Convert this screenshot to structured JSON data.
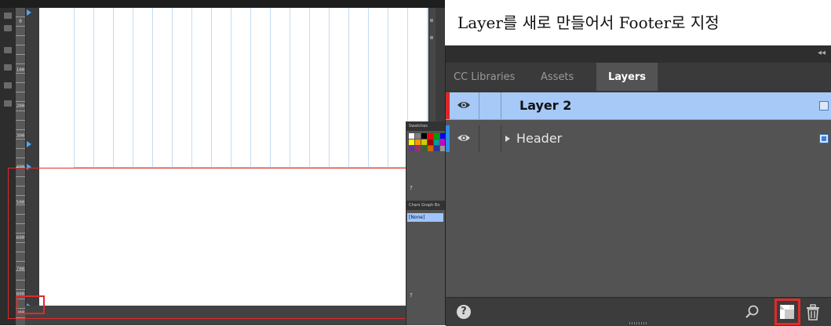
{
  "caption": {
    "text": "Layer를 새로 만들어서 Footer로 지정"
  },
  "layers_panel": {
    "tabs": [
      {
        "label": "CC Libraries",
        "active": false
      },
      {
        "label": "Assets",
        "active": false
      },
      {
        "label": "Layers",
        "active": true
      }
    ],
    "collapse_glyph": "◂◂",
    "layers": [
      {
        "name": "Layer 2",
        "selected": true,
        "visible": true,
        "strip_color": "#e0262a"
      },
      {
        "name": "Header",
        "selected": false,
        "visible": true,
        "strip_color": "#2f8fe6"
      }
    ],
    "help_label": "?"
  },
  "ruler": {
    "labels": [
      "0",
      "100",
      "200",
      "300",
      "400",
      "500",
      "600",
      "700",
      "800",
      "900"
    ]
  },
  "mini_panels": {
    "swatches_title": "Swatches",
    "char_tabs": "Chars Graph Bo",
    "selected_item": "[None]",
    "help_label": "?",
    "swatch_colors": [
      "#ffffff",
      "#808080",
      "#000000",
      "#ff0000",
      "#00a000",
      "#0000ff",
      "#ffff00",
      "#ff9900",
      "#cccc00",
      "#990000",
      "#009999",
      "#cc00cc",
      "#663399",
      "#993366",
      "#336633",
      "#cc6600",
      "#333399",
      "#999999"
    ]
  },
  "colors": {
    "selection_row": "#a6c9f7",
    "panel_bg": "#535353",
    "annotation": "#e22a2a"
  }
}
